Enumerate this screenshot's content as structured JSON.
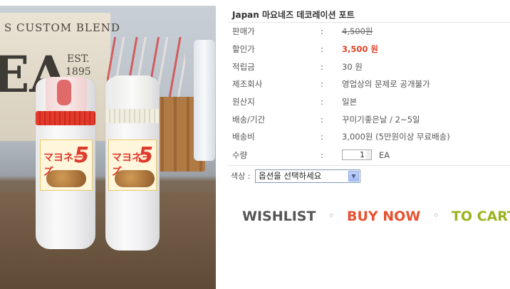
{
  "product": {
    "title": "Japan 마요네즈 데코레이션 포트",
    "image": {
      "sign_text": "S CUSTOM BLEND",
      "sign_big": "EA",
      "sign_est_line1": "EST.",
      "sign_est_line2": "1895",
      "bottle_label_text": "マヨネーズ",
      "bottle_label_number": "5"
    }
  },
  "info": {
    "colon": ":",
    "rows": [
      {
        "key": "판매가",
        "value": "4,500원"
      },
      {
        "key": "할인가",
        "value": "3,500 원"
      },
      {
        "key": "적립금",
        "value": "30 원"
      },
      {
        "key": "제조회사",
        "value": "영업상의 문제로 공개불가"
      },
      {
        "key": "원산지",
        "value": "일본"
      },
      {
        "key": "배송/기간",
        "value": "꾸미기좋은날 / 2~5일"
      },
      {
        "key": "배송비",
        "value": "3,000원 (5만원이상 무료배송)"
      },
      {
        "key": "수량",
        "value": "EA"
      }
    ],
    "quantity": "1"
  },
  "option": {
    "label": "색상 :",
    "selected": "옵션을 선택하세요"
  },
  "actions": {
    "wishlist": "WISHLIST",
    "buy_now": "BUY NOW",
    "to_cart": "TO CART",
    "separator": "◦"
  },
  "colors": {
    "sale_price": "#e0442a",
    "wishlist": "#555555",
    "buy_now": "#e8512f",
    "to_cart": "#9cb21f"
  }
}
